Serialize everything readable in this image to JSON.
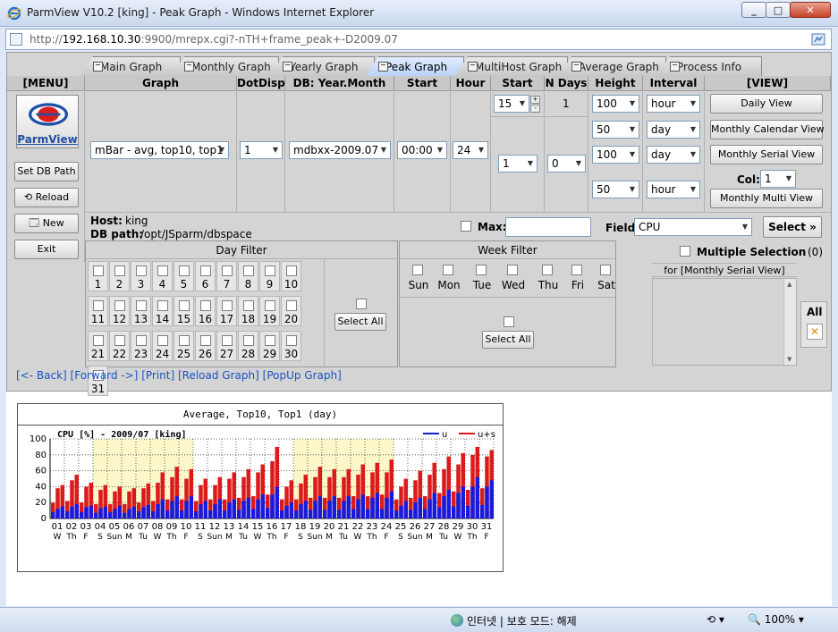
{
  "window": {
    "title": "ParmView V10.2 [king] - Peak Graph - Windows Internet Explorer",
    "url_prefix": "http://",
    "url_host": "192.168.10.30",
    "url_rest": ":9900/mrepx.cgi?-nTH+frame_peak+-D2009.07"
  },
  "tabs": [
    "Main Graph",
    "Monthly Graph",
    "Yearly Graph",
    "Peak Graph",
    "MultiHost Graph",
    "Average Graph",
    "Process Info"
  ],
  "active_tab": "Peak Graph",
  "headers": {
    "menu": "[MENU]",
    "graph": "Graph",
    "dotdisp": "DotDisp",
    "db": "DB: Year.Month",
    "start_hour": "Start hour",
    "hour": "Hour",
    "start_day": "Start Day",
    "n_days": "N Days",
    "height": "Height",
    "interval": "Interval",
    "view": "[VIEW]"
  },
  "menu": {
    "logo_text": "ParmView",
    "set_db_path": "Set DB Path",
    "reload": "Reload",
    "new": "New",
    "exit": "Exit"
  },
  "controls": {
    "graph": "mBar - avg, top10, top1",
    "dotdisp": "1",
    "db": "mdbxx-2009.07",
    "start_hour": "00:00",
    "hour": "24",
    "start_day_top": "15",
    "n_days_top": "1",
    "start_day": "1",
    "n_days": "0",
    "heights": [
      "100",
      "50",
      "100",
      "50"
    ],
    "intervals": [
      "hour",
      "day",
      "day",
      "hour"
    ]
  },
  "view": {
    "daily": "Daily  View",
    "monthly_calendar": "Monthly Calendar View",
    "monthly_serial": "Monthly Serial View",
    "col_label": "Col:",
    "col_value": "1",
    "monthly_multi": "Monthly  Multi  View"
  },
  "host": {
    "host_label": "Host:",
    "host_value": "king",
    "db_label": "DB path:",
    "db_value": "/opt/JSparm/dbspace"
  },
  "max_label": "Max:",
  "field_label": "Field:",
  "field_value": "CPU",
  "select_label": "Select",
  "day_filter": {
    "title": "Day Filter",
    "days": [
      "1",
      "2",
      "3",
      "4",
      "5",
      "6",
      "7",
      "8",
      "9",
      "10",
      "11",
      "12",
      "13",
      "14",
      "15",
      "16",
      "17",
      "18",
      "19",
      "20",
      "21",
      "22",
      "23",
      "24",
      "25",
      "26",
      "27",
      "28",
      "29",
      "30",
      "31"
    ],
    "select_all": "Select All"
  },
  "week_filter": {
    "title": "Week Filter",
    "days": [
      "Sun",
      "Mon",
      "Tue",
      "Wed",
      "Thu",
      "Fri",
      "Sat"
    ],
    "select_all": "Select All"
  },
  "multi_select": {
    "title": "Multiple Selection",
    "count": "(0)",
    "for_label": "for [Monthly Serial View]",
    "all": "All"
  },
  "links": [
    "[<- Back]",
    "[Forward ->]",
    "[Print]",
    "[Reload Graph]",
    "[PopUp Graph]"
  ],
  "chart_data": {
    "type": "bar",
    "title": "Average, Top10, Top1 (day)",
    "subtitle": "CPU [%] - 2009/07 [king]",
    "ylim": [
      0,
      100
    ],
    "yticks": [
      0,
      20,
      40,
      60,
      80,
      100
    ],
    "categories": [
      "01",
      "02",
      "03",
      "04",
      "05",
      "06",
      "07",
      "08",
      "09",
      "10",
      "11",
      "12",
      "13",
      "14",
      "15",
      "16",
      "17",
      "18",
      "19",
      "20",
      "21",
      "22",
      "23",
      "24",
      "25",
      "26",
      "27",
      "28",
      "29",
      "30",
      "31"
    ],
    "weekdays": [
      "W",
      "Th",
      "F",
      "S",
      "Sun",
      "M",
      "Tu",
      "W",
      "Th",
      "F",
      "S",
      "Sun",
      "M",
      "Tu",
      "W",
      "Th",
      "F",
      "S",
      "Sun",
      "M",
      "Tu",
      "W",
      "Th",
      "F",
      "S",
      "Sun",
      "M",
      "Tu",
      "W",
      "Th",
      "F"
    ],
    "highlight_ranges": [
      [
        "04",
        "10"
      ],
      [
        "18",
        "24"
      ]
    ],
    "series": [
      {
        "name": "u",
        "color": "#1a1adc",
        "bars": [
          [
            8,
            12,
            15
          ],
          [
            9,
            15,
            18
          ],
          [
            8,
            14,
            16
          ],
          [
            7,
            13,
            15
          ],
          [
            8,
            12,
            16
          ],
          [
            7,
            12,
            15
          ],
          [
            9,
            14,
            17
          ],
          [
            9,
            18,
            24
          ],
          [
            10,
            22,
            28
          ],
          [
            10,
            22,
            28
          ],
          [
            9,
            18,
            22
          ],
          [
            10,
            18,
            24
          ],
          [
            10,
            20,
            24
          ],
          [
            11,
            22,
            26
          ],
          [
            12,
            24,
            30
          ],
          [
            13,
            30,
            40
          ],
          [
            10,
            16,
            20
          ],
          [
            10,
            18,
            22
          ],
          [
            11,
            22,
            28
          ],
          [
            11,
            22,
            28
          ],
          [
            11,
            22,
            28
          ],
          [
            12,
            24,
            30
          ],
          [
            12,
            26,
            32
          ],
          [
            12,
            26,
            34
          ],
          [
            10,
            16,
            22
          ],
          [
            11,
            20,
            26
          ],
          [
            12,
            24,
            32
          ],
          [
            14,
            28,
            36
          ],
          [
            15,
            32,
            40
          ],
          [
            16,
            40,
            52
          ],
          [
            17,
            40,
            48
          ]
        ]
      },
      {
        "name": "u+s",
        "color": "#dc1a1a",
        "bars": [
          [
            20,
            38,
            42
          ],
          [
            22,
            48,
            55
          ],
          [
            20,
            40,
            45
          ],
          [
            18,
            36,
            42
          ],
          [
            18,
            34,
            40
          ],
          [
            18,
            34,
            38
          ],
          [
            20,
            38,
            44
          ],
          [
            22,
            45,
            58
          ],
          [
            24,
            52,
            65
          ],
          [
            24,
            50,
            62
          ],
          [
            22,
            42,
            50
          ],
          [
            24,
            42,
            52
          ],
          [
            24,
            50,
            58
          ],
          [
            26,
            52,
            62
          ],
          [
            28,
            58,
            68
          ],
          [
            30,
            72,
            90
          ],
          [
            24,
            40,
            48
          ],
          [
            24,
            44,
            55
          ],
          [
            26,
            52,
            65
          ],
          [
            26,
            52,
            62
          ],
          [
            26,
            52,
            62
          ],
          [
            28,
            55,
            68
          ],
          [
            28,
            58,
            70
          ],
          [
            30,
            58,
            74
          ],
          [
            24,
            40,
            50
          ],
          [
            26,
            48,
            60
          ],
          [
            28,
            55,
            70
          ],
          [
            32,
            62,
            78
          ],
          [
            34,
            68,
            82
          ],
          [
            36,
            80,
            90
          ],
          [
            38,
            78,
            86
          ]
        ]
      }
    ]
  },
  "status": {
    "zone": "인터넷 | 보호 모드: 해제",
    "zoom": "100%"
  }
}
